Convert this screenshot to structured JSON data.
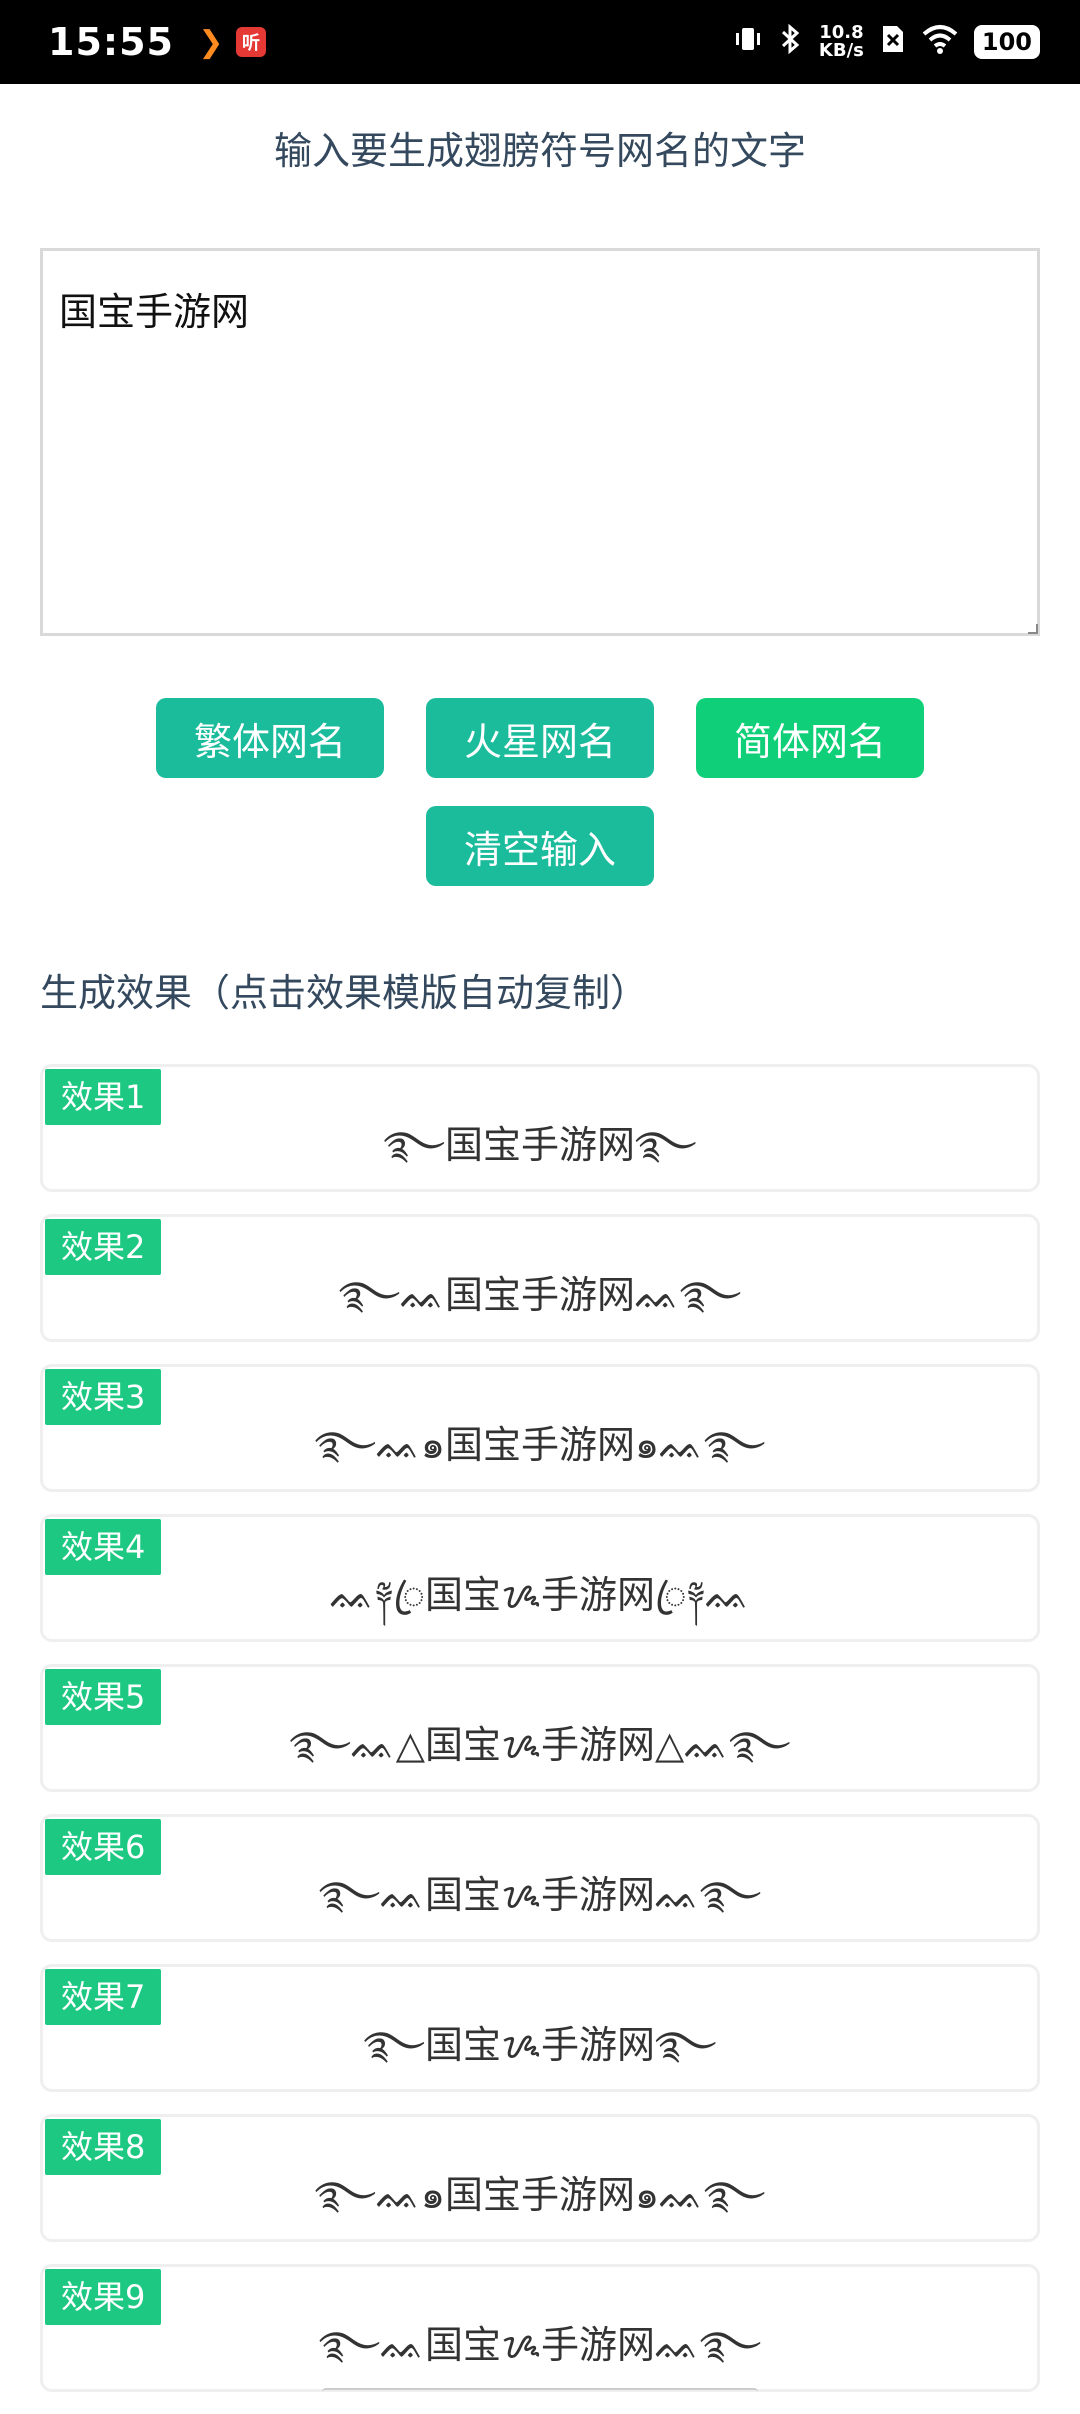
{
  "status": {
    "time": "15:55",
    "app_icon_1": "❯",
    "app_icon_2": "听",
    "speed_value": "10.8",
    "speed_unit": "KB/s",
    "battery": "100"
  },
  "page": {
    "title": "输入要生成翅膀符号网名的文字",
    "input_value": "国宝手游网"
  },
  "buttons": {
    "traditional": "繁体网名",
    "mars": "火星网名",
    "simplified": "简体网名",
    "clear": "清空输入"
  },
  "section_label": "生成效果（点击效果模版自动复制）",
  "results": [
    {
      "badge": "效果1",
      "text": "࿐国宝手游网࿐"
    },
    {
      "badge": "效果2",
      "text": "࿐ᨐ国宝手游网ᨐ࿐"
    },
    {
      "badge": "效果3",
      "text": "࿐ᨐ๑国宝手游网๑ᨐ࿐"
    },
    {
      "badge": "效果4",
      "text": "ᨐ༈ꦿ国宝ᝰ手游网ꦿ༈ᨐ"
    },
    {
      "badge": "效果5",
      "text": "࿐ᨐ△国宝ᝰ手游网△ᨐ࿐"
    },
    {
      "badge": "效果6",
      "text": "࿐ᨐ国宝ᝰ手游网ᨐ࿐"
    },
    {
      "badge": "效果7",
      "text": "࿐国宝ᝰ手游网࿐"
    },
    {
      "badge": "效果8",
      "text": "࿐ᨐ๑国宝手游网๑ᨐ࿐"
    },
    {
      "badge": "效果9",
      "text": "࿐ᨐ国宝ᝰ手游网ᨐ࿐"
    }
  ]
}
